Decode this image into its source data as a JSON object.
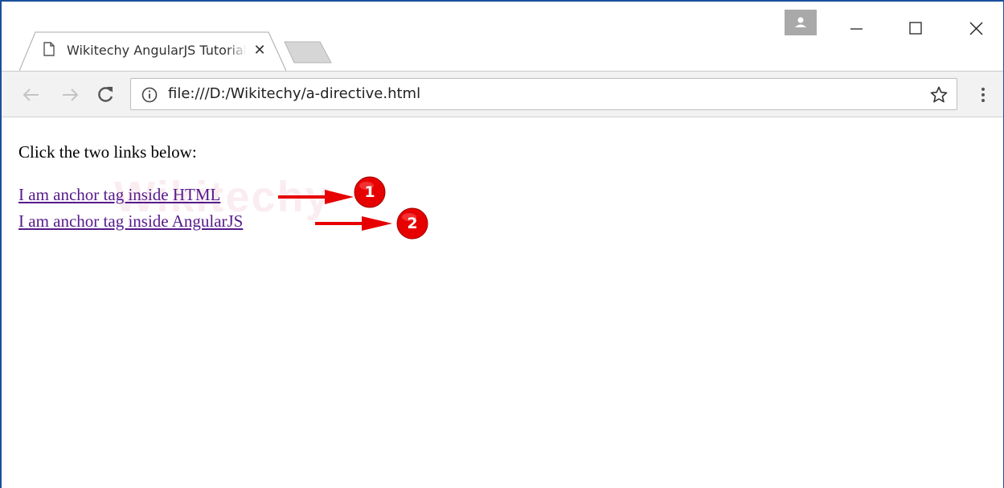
{
  "browser": {
    "tab": {
      "title": "Wikitechy AngularJS Tutorial",
      "close_glyph": "✕",
      "page_icon": "page-icon"
    },
    "address_bar": {
      "url": "file:///D:/Wikitechy/a-directive.html",
      "info_icon": "info-icon",
      "star_icon": "star-icon"
    },
    "nav_icons": [
      "back-arrow-icon",
      "forward-arrow-icon",
      "reload-icon"
    ],
    "window_controls": [
      "profile-icon",
      "minimize-icon",
      "maximize-icon",
      "close-icon"
    ],
    "menu_icon": "kebab-menu-icon"
  },
  "page": {
    "intro": "Click the two links below:",
    "links": [
      {
        "label": "I am anchor tag inside HTML"
      },
      {
        "label": "I am anchor tag inside AngularJS"
      }
    ],
    "watermark": "Wikitechy"
  },
  "annotations": [
    {
      "number": "1"
    },
    {
      "number": "2"
    }
  ],
  "colors": {
    "link_visited": "#551a8b",
    "annotation_red": "#e60000",
    "window_border": "#1b4f9c",
    "toolbar_bg": "#f2f2f2"
  }
}
